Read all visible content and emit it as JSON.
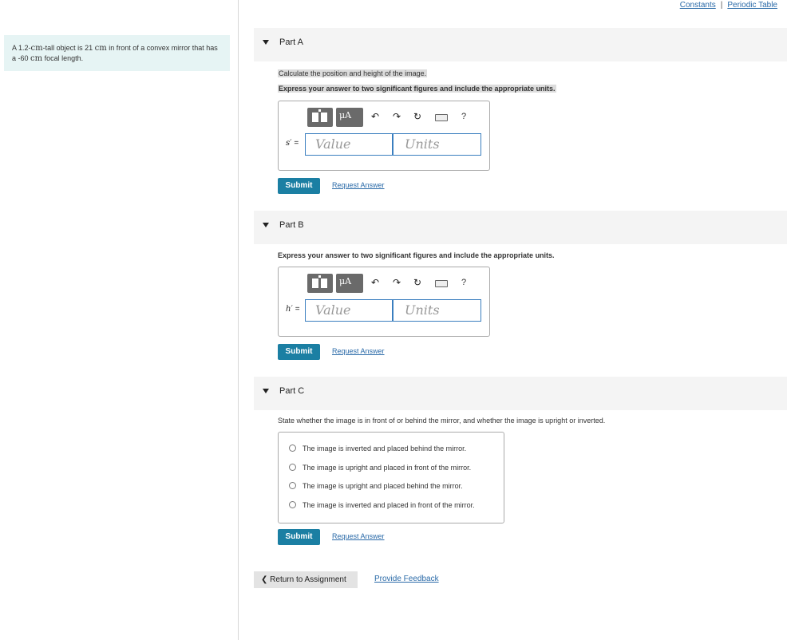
{
  "header": {
    "constants_label": "Constants",
    "separator": "|",
    "periodic_table_label": "Periodic Table"
  },
  "problem": {
    "text_1": "A 1.2-",
    "unit_1": "cm",
    "text_2": "-tall object is 21 ",
    "unit_2": "cm",
    "text_3": " in front of a convex mirror that has a -60 ",
    "unit_3": "cm",
    "text_4": " focal length."
  },
  "partA": {
    "title": "Part A",
    "instruction_1": "Calculate the position and height of the image.",
    "instruction_2": "Express your answer to two significant figures and include the appropriate units.",
    "var_label": "s′",
    "equals": "=",
    "value_placeholder": "Value",
    "units_placeholder": "Units",
    "submit_label": "Submit",
    "request_label": "Request Answer"
  },
  "partB": {
    "title": "Part B",
    "instruction": "Express your answer to two significant figures and include the appropriate units.",
    "var_label": "h′",
    "equals": "=",
    "value_placeholder": "Value",
    "units_placeholder": "Units",
    "submit_label": "Submit",
    "request_label": "Request Answer"
  },
  "partC": {
    "title": "Part C",
    "instruction": "State whether the image is in front of or behind the mirror, and whether the image is upright or inverted.",
    "options": [
      "The image is inverted and placed behind the mirror.",
      "The image is upright and placed in front of the mirror.",
      "The image is upright and placed behind the mirror.",
      "The image is inverted and placed in front of the mirror."
    ],
    "submit_label": "Submit",
    "request_label": "Request Answer"
  },
  "toolbar": {
    "mu_label": "μA",
    "undo_icon": "↶",
    "redo_icon": "↷",
    "reset_icon": "↻",
    "help_label": "?"
  },
  "footer": {
    "return_label": "❮ Return to Assignment",
    "feedback_label": "Provide Feedback"
  }
}
